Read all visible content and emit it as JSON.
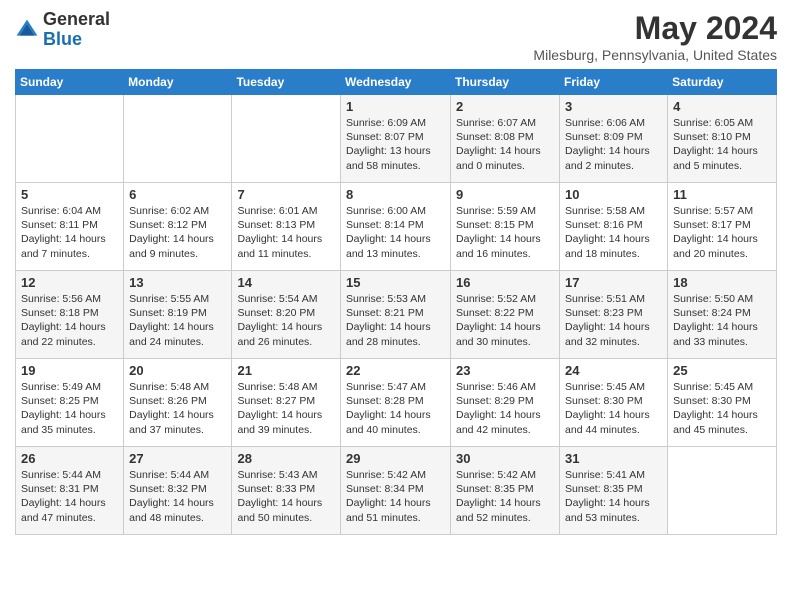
{
  "header": {
    "logo_line1": "General",
    "logo_line2": "Blue",
    "title": "May 2024",
    "location": "Milesburg, Pennsylvania, United States"
  },
  "days_of_week": [
    "Sunday",
    "Monday",
    "Tuesday",
    "Wednesday",
    "Thursday",
    "Friday",
    "Saturday"
  ],
  "weeks": [
    [
      {
        "day": "",
        "info": ""
      },
      {
        "day": "",
        "info": ""
      },
      {
        "day": "",
        "info": ""
      },
      {
        "day": "1",
        "info": "Sunrise: 6:09 AM\nSunset: 8:07 PM\nDaylight: 13 hours\nand 58 minutes."
      },
      {
        "day": "2",
        "info": "Sunrise: 6:07 AM\nSunset: 8:08 PM\nDaylight: 14 hours\nand 0 minutes."
      },
      {
        "day": "3",
        "info": "Sunrise: 6:06 AM\nSunset: 8:09 PM\nDaylight: 14 hours\nand 2 minutes."
      },
      {
        "day": "4",
        "info": "Sunrise: 6:05 AM\nSunset: 8:10 PM\nDaylight: 14 hours\nand 5 minutes."
      }
    ],
    [
      {
        "day": "5",
        "info": "Sunrise: 6:04 AM\nSunset: 8:11 PM\nDaylight: 14 hours\nand 7 minutes."
      },
      {
        "day": "6",
        "info": "Sunrise: 6:02 AM\nSunset: 8:12 PM\nDaylight: 14 hours\nand 9 minutes."
      },
      {
        "day": "7",
        "info": "Sunrise: 6:01 AM\nSunset: 8:13 PM\nDaylight: 14 hours\nand 11 minutes."
      },
      {
        "day": "8",
        "info": "Sunrise: 6:00 AM\nSunset: 8:14 PM\nDaylight: 14 hours\nand 13 minutes."
      },
      {
        "day": "9",
        "info": "Sunrise: 5:59 AM\nSunset: 8:15 PM\nDaylight: 14 hours\nand 16 minutes."
      },
      {
        "day": "10",
        "info": "Sunrise: 5:58 AM\nSunset: 8:16 PM\nDaylight: 14 hours\nand 18 minutes."
      },
      {
        "day": "11",
        "info": "Sunrise: 5:57 AM\nSunset: 8:17 PM\nDaylight: 14 hours\nand 20 minutes."
      }
    ],
    [
      {
        "day": "12",
        "info": "Sunrise: 5:56 AM\nSunset: 8:18 PM\nDaylight: 14 hours\nand 22 minutes."
      },
      {
        "day": "13",
        "info": "Sunrise: 5:55 AM\nSunset: 8:19 PM\nDaylight: 14 hours\nand 24 minutes."
      },
      {
        "day": "14",
        "info": "Sunrise: 5:54 AM\nSunset: 8:20 PM\nDaylight: 14 hours\nand 26 minutes."
      },
      {
        "day": "15",
        "info": "Sunrise: 5:53 AM\nSunset: 8:21 PM\nDaylight: 14 hours\nand 28 minutes."
      },
      {
        "day": "16",
        "info": "Sunrise: 5:52 AM\nSunset: 8:22 PM\nDaylight: 14 hours\nand 30 minutes."
      },
      {
        "day": "17",
        "info": "Sunrise: 5:51 AM\nSunset: 8:23 PM\nDaylight: 14 hours\nand 32 minutes."
      },
      {
        "day": "18",
        "info": "Sunrise: 5:50 AM\nSunset: 8:24 PM\nDaylight: 14 hours\nand 33 minutes."
      }
    ],
    [
      {
        "day": "19",
        "info": "Sunrise: 5:49 AM\nSunset: 8:25 PM\nDaylight: 14 hours\nand 35 minutes."
      },
      {
        "day": "20",
        "info": "Sunrise: 5:48 AM\nSunset: 8:26 PM\nDaylight: 14 hours\nand 37 minutes."
      },
      {
        "day": "21",
        "info": "Sunrise: 5:48 AM\nSunset: 8:27 PM\nDaylight: 14 hours\nand 39 minutes."
      },
      {
        "day": "22",
        "info": "Sunrise: 5:47 AM\nSunset: 8:28 PM\nDaylight: 14 hours\nand 40 minutes."
      },
      {
        "day": "23",
        "info": "Sunrise: 5:46 AM\nSunset: 8:29 PM\nDaylight: 14 hours\nand 42 minutes."
      },
      {
        "day": "24",
        "info": "Sunrise: 5:45 AM\nSunset: 8:30 PM\nDaylight: 14 hours\nand 44 minutes."
      },
      {
        "day": "25",
        "info": "Sunrise: 5:45 AM\nSunset: 8:30 PM\nDaylight: 14 hours\nand 45 minutes."
      }
    ],
    [
      {
        "day": "26",
        "info": "Sunrise: 5:44 AM\nSunset: 8:31 PM\nDaylight: 14 hours\nand 47 minutes."
      },
      {
        "day": "27",
        "info": "Sunrise: 5:44 AM\nSunset: 8:32 PM\nDaylight: 14 hours\nand 48 minutes."
      },
      {
        "day": "28",
        "info": "Sunrise: 5:43 AM\nSunset: 8:33 PM\nDaylight: 14 hours\nand 50 minutes."
      },
      {
        "day": "29",
        "info": "Sunrise: 5:42 AM\nSunset: 8:34 PM\nDaylight: 14 hours\nand 51 minutes."
      },
      {
        "day": "30",
        "info": "Sunrise: 5:42 AM\nSunset: 8:35 PM\nDaylight: 14 hours\nand 52 minutes."
      },
      {
        "day": "31",
        "info": "Sunrise: 5:41 AM\nSunset: 8:35 PM\nDaylight: 14 hours\nand 53 minutes."
      },
      {
        "day": "",
        "info": ""
      }
    ]
  ]
}
